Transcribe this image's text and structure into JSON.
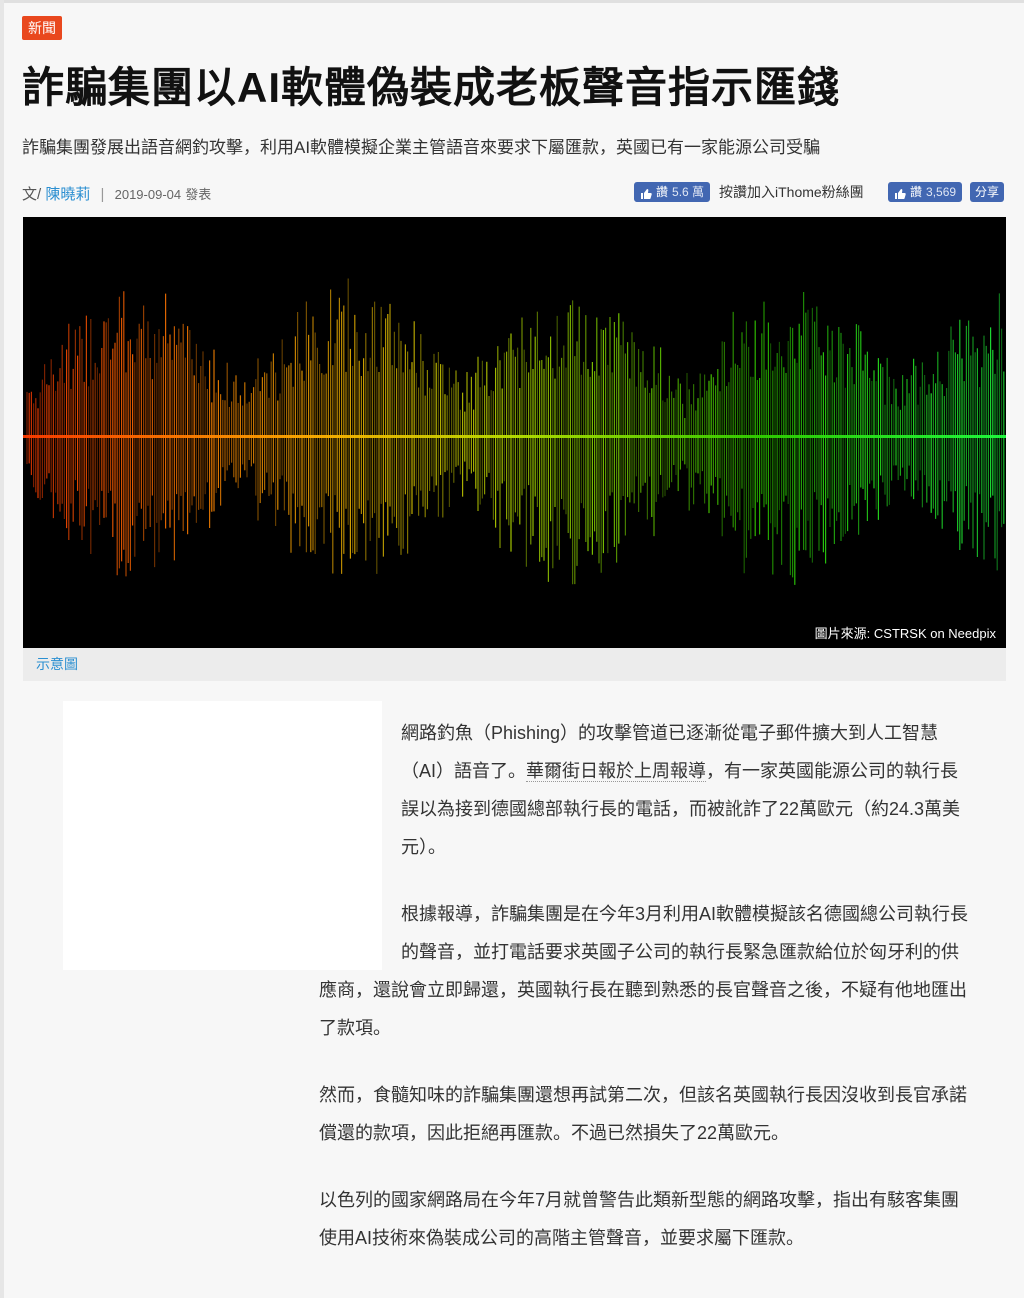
{
  "article": {
    "category": "新聞",
    "title": "詐騙集團以AI軟體偽裝成老板聲音指示匯錢",
    "subtitle": "詐騙集團發展出語音網釣攻擊，利用AI軟體模擬企業主管語音來要求下屬匯款，英國已有一家能源公司受騙",
    "byline_prefix": "文/",
    "author": "陳曉莉",
    "byline_sep": "|",
    "date": "2019-09-04",
    "posted_label": "發表",
    "image_credit": "圖片來源: CSTRSK on Needpix",
    "image_caption": "示意圖"
  },
  "social": {
    "like_label": "讚",
    "like_count_1": "5.6 萬",
    "join_text": "按讚加入iThome粉絲團",
    "like_count_2": "3,569",
    "share_label": "分享",
    "brand_color": "#4267b2"
  },
  "body": {
    "p1_lines": [
      "網路釣魚（Phishing）的攻擊管道已逐漸從電子郵件擴大到人工智慧",
      "（AI）語音了。",
      "華爾街日報於上周報導",
      "，有一家英國能源公司的執行長",
      "誤以為接到德國總部執行長的電話，而被訛詐了22萬歐元（約24.3萬美",
      "元）。"
    ],
    "p2_lines": [
      "根據報導，詐騙集團是在今年3月利用AI軟體模擬該名德國總公司執行長",
      "的聲音，並打電話要求英國子公司的執行長緊急匯款給位於匈牙利的供",
      "應商，還說會立即歸還，英國執行長在聽到熟悉的長官聲音之後，不疑有他地匯出",
      "了款項。"
    ],
    "p3_lines": [
      "然而，食髓知味的詐騙集團還想再試第二次，但該名英國執行長因沒收到長官承諾",
      "償還的款項，因此拒絕再匯款。不過已然損失了22萬歐元。"
    ],
    "p4_lines": [
      "以色列的國家網路局在今年7月就曾警告此類新型態的網路攻擊，指出有駭客集團",
      "使用AI技術來偽裝成公司的高階主管聲音，並要求屬下匯款。"
    ]
  },
  "colors": {
    "category_bg": "#e9481e",
    "link": "#2b8fd1"
  }
}
